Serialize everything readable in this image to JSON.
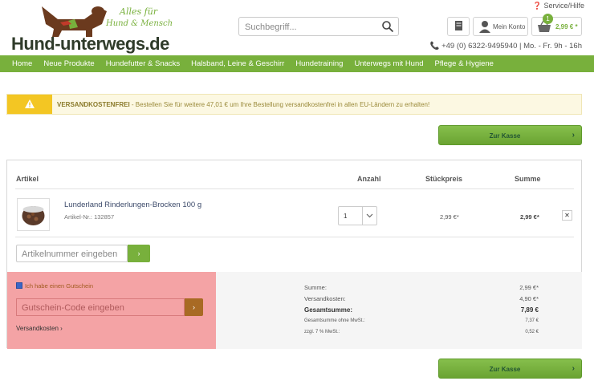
{
  "header": {
    "logo_text": "Hund-unterwegs.de",
    "tagline_1": "Alles für",
    "tagline_2": "Hund & Mensch",
    "service_label": "Service/Hilfe",
    "search_placeholder": "Suchbegriff...",
    "account_label": "Mein Konto",
    "cart_count": "1",
    "cart_total": "2,99 € *",
    "phone": "+49 (0) 6322-9495940 | Mo. - Fr. 9h - 16h"
  },
  "nav": {
    "items": [
      "Home",
      "Neue Produkte",
      "Hundefutter & Snacks",
      "Halsband, Leine & Geschirr",
      "Hundetraining",
      "Unterwegs mit Hund",
      "Pflege & Hygiene"
    ]
  },
  "notice": {
    "highlight": "VERSANDKOSTENFREI",
    "text": " - Bestellen Sie für weitere 47,01 € um Ihre Bestellung versandkostenfrei in allen EU-Ländern zu erhalten!"
  },
  "checkout_label": "Zur Kasse",
  "table": {
    "col_article": "Artikel",
    "col_qty": "Anzahl",
    "col_unit": "Stückpreis",
    "col_sum": "Summe"
  },
  "item": {
    "name": "Lunderland Rinderlungen-Brocken 100 g",
    "number": "Artikel-Nr.: 132857",
    "quantity": "1",
    "unit_price": "2,99 €*",
    "sum": "2,99 €*",
    "remove": "✕"
  },
  "article_input_placeholder": "Artikelnummer eingeben",
  "voucher": {
    "checkbox_label": "Ich habe einen Gutschein",
    "checked": true,
    "input_placeholder": "Gutschein-Code eingeben",
    "shipping_link": "Versandkosten"
  },
  "summary": {
    "rows": [
      {
        "label": "Summe:",
        "value": "2,99 €*"
      },
      {
        "label": "Versandkosten:",
        "value": "4,90 €*"
      },
      {
        "label": "Gesamtsumme:",
        "value": "7,89 €"
      },
      {
        "label": "Gesamtsumme ohne MwSt.:",
        "value": "7,37 €"
      },
      {
        "label": "zzgl. 7 % MwSt.:",
        "value": "0,52 €"
      }
    ]
  },
  "colors": {
    "brand_green": "#78b03c",
    "warning_yellow": "#f3c623",
    "voucher_highlight": "#f4a3a5"
  }
}
